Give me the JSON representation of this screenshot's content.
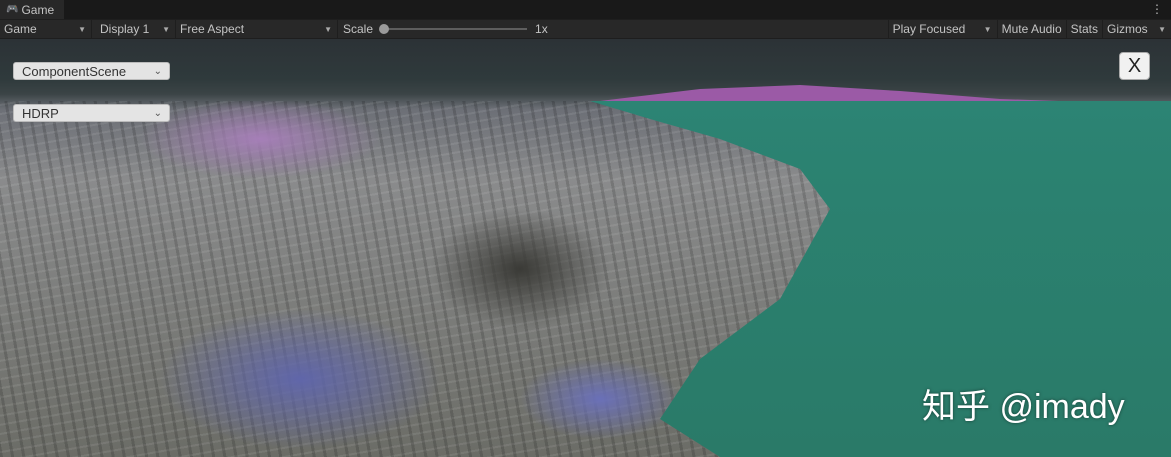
{
  "tab": {
    "title": "Game",
    "icon": "gamepad-icon"
  },
  "toolbar": {
    "mode": "Game",
    "display": "Display 1",
    "aspect": "Free Aspect",
    "scale_label": "Scale",
    "scale_value": "1x",
    "scale_fraction": 0,
    "play_focused": "Play Focused",
    "mute_audio": "Mute Audio",
    "stats": "Stats",
    "gizmos": "Gizmos"
  },
  "overlay": {
    "scene_dropdown": "ComponentScene",
    "pipeline_dropdown": "HDRP",
    "close_label": "X",
    "watermark": "知乎 @imady"
  }
}
